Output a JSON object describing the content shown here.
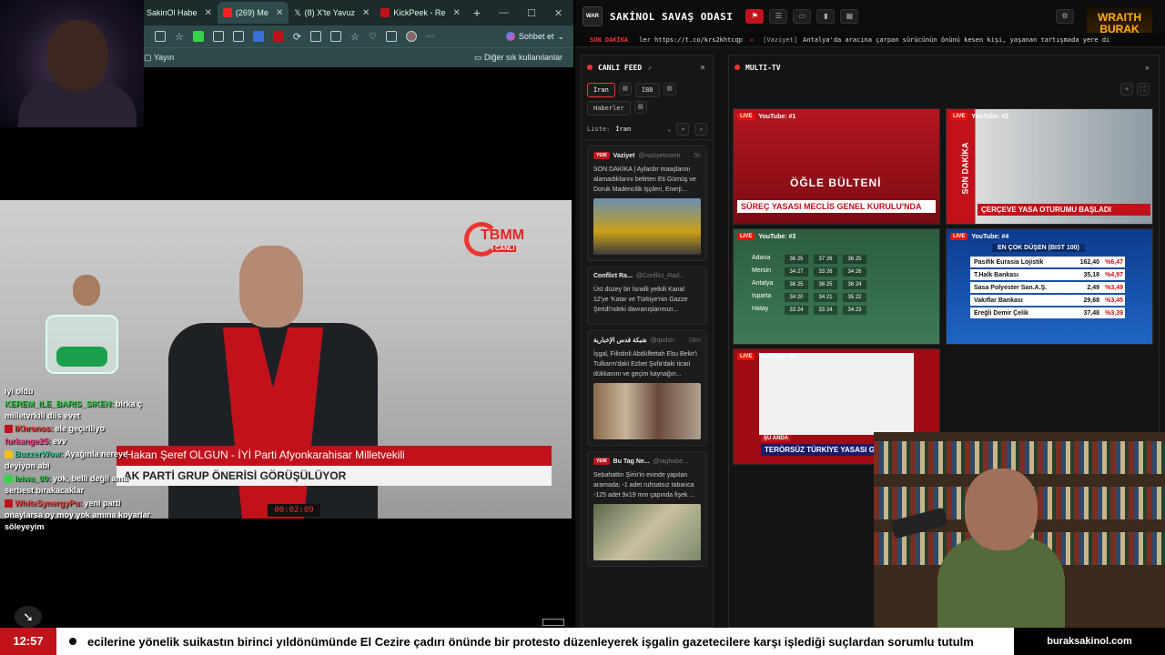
{
  "browser": {
    "tabs": [
      {
        "label": "SakinOl Habe",
        "color": "#ffffff"
      },
      {
        "label": "(269) Me",
        "color": "#ff2020"
      },
      {
        "label": "(8) X'te Yavuz",
        "color": "#ffffff"
      },
      {
        "label": "KickPeek - Re",
        "color": "#c1121b"
      }
    ],
    "chat_button": "Sohbet et",
    "bookmarks": {
      "left": "Yayın",
      "right": "Diğer sık kullanılanlar"
    }
  },
  "video": {
    "logo_text": "TBMM",
    "logo_sub": "CANLI",
    "lower_third_1": "Hakan Şeref OLGUN - İYİ Parti Afyonkarahisar Milletvekili",
    "lower_third_2": "AK PARTİ GRUP ÖNERİSİ GÖRÜŞÜLÜYOR",
    "timecode": "00:02:09"
  },
  "chat": [
    {
      "user": "",
      "text": "iyi oldu",
      "color": "#ffffff",
      "badge": ""
    },
    {
      "user": "KEREM_ILE_BARIS_SIKEN:",
      "text": "birka ç milletvrkili diis evet",
      "color": "#36d34b",
      "badge": ""
    },
    {
      "user": "IKhronos:",
      "text": "ele geçiriliyo",
      "color": "#ff3333",
      "badge": "#c1121b"
    },
    {
      "user": "furkange25:",
      "text": "evv",
      "color": "#ff3d8b",
      "badge": ""
    },
    {
      "user": "BuzzerWow:",
      "text": "Ayağınla nereye deyiyon abi",
      "color": "#36d3a0",
      "badge": "#f0c020"
    },
    {
      "user": "leiwa_00:",
      "text": "yok, belli değil ama serbest bırakacaklar",
      "color": "#36d34b",
      "badge": "#36d34b"
    },
    {
      "user": "WhiteSynergyPu:",
      "text": "yeni parti onaylarsa oy moy yok amına koyarlar söleyeyim",
      "color": "#ff4444",
      "badge": "#c1121b"
    }
  ],
  "dashboard": {
    "title": "SAKİNOL SAVAŞ ODASI",
    "brand": {
      "line1": "WRAITH",
      "line2": "BURAK",
      "color": "#ffb000"
    },
    "ticker": {
      "label": "SON DAKİKA",
      "url": "ler https://t.co/krs2khtcqp",
      "source": "[Vaziyet]",
      "text": "Antalya'da aracına çarpan sürücünün önünü kesen kişi, yaşanan tartışmada yere di"
    },
    "feed": {
      "title": "CANLI FEED",
      "tabs": [
        "İran",
        "İBB",
        "Haberler"
      ],
      "list_label": "Liste:",
      "list_value": "İran",
      "cards": [
        {
          "badge": "YENİ",
          "name": "Vaziyet",
          "handle": "@vaziyetcomtr",
          "time": "5h",
          "text": "SON DAKİKA | Aylardır maaşlarını alamadıklarını belirten Eti Gümüş ve Doruk Madencilik işçileri, Enerji...",
          "image_color": "#c9a018"
        },
        {
          "badge": "",
          "name": "Conflict Ra...",
          "handle": "@Conflict_Rad...",
          "time": "",
          "text": "Üst düzey bir İsrailli yetkili Kanal 12'ye 'Katar ve Türkiye'nin Gazze Şeridi'ndeki davranışlarımızı...",
          "image_color": ""
        },
        {
          "badge": "",
          "name": "شبكة قدس الإخبارية",
          "handle": "@qudsn",
          "time": "28m",
          "text": "İşgal, Filistinli Abdülfettah Ebu Bekir'i Tulkarm'daki Ezbet Şufa'daki ticari dükkanını ve geçim kaynağın...",
          "image_color": "#8a6a4a"
        },
        {
          "badge": "YENİ",
          "name": "Bu Tag Ne...",
          "handle": "@taghabe...",
          "time": "",
          "text": "Sebahattin Şirin'in evinde yapılan aramada: -1 adet ruhsatsız tabanca -125 adet 9x19 mm çapında fişek ...",
          "image_color": "#5a6a4a"
        }
      ]
    },
    "multitv": {
      "title": "MULTI-TV",
      "players": [
        {
          "live": "LIVE",
          "name": "YouTube: #1",
          "caption": "ÖĞLE BÜLTENİ",
          "headline": "SÜREÇ YASASI MECLİS GENEL KURULU'NDA"
        },
        {
          "live": "LIVE",
          "name": "YouTube: #2",
          "caption": "SON DAKİKA",
          "headline": "ÇERÇEVE YASA OTURUMU BAŞLADI"
        },
        {
          "live": "LIVE",
          "name": "YouTube: #3",
          "caption": "",
          "headline": "",
          "weather": [
            {
              "city": "Adana",
              "vals": [
                "36 25",
                "37 26",
                "36 25"
              ]
            },
            {
              "city": "Mersin",
              "vals": [
                "34 27",
                "33 26",
                "34 26"
              ]
            },
            {
              "city": "Antalya",
              "vals": [
                "36 25",
                "36 25",
                "36 24"
              ]
            },
            {
              "city": "Isparta",
              "vals": [
                "34 20",
                "34 21",
                "35 22"
              ]
            },
            {
              "city": "Hatay",
              "vals": [
                "33 24",
                "33 24",
                "34 23"
              ]
            }
          ]
        },
        {
          "live": "LIVE",
          "name": "YouTube: #4",
          "caption": "EN ÇOK DÜŞEN (BIST 100)",
          "headline": "",
          "stocks": [
            {
              "name": "Pasifik Eurasia Lojistik",
              "value": "162,40",
              "change": "%6,47"
            },
            {
              "name": "T.Halk Bankası",
              "value": "35,18",
              "change": "%4,97"
            },
            {
              "name": "Sasa Polyester San.A.Ş.",
              "value": "2,49",
              "change": "%3,49"
            },
            {
              "name": "Vakıflar Bankası",
              "value": "29,68",
              "change": "%3,45"
            },
            {
              "name": "Ereğli Demir Çelik",
              "value": "37,48",
              "change": "%3,39"
            }
          ]
        },
        {
          "live": "LIVE",
          "name": "YouTube: #5",
          "caption": "ŞU ANDA",
          "headline": "TERÖRSÜZ TÜRKİYE YASASI GÖRÜŞ"
        }
      ]
    }
  },
  "bottom": {
    "time": "12:57",
    "scroll_text": "ecilerine yönelik suikastın birinci yıldönümünde El Cezire çadırı önünde bir protesto düzenleyerek işgalin gazetecilere karşı işlediği suçlardan sorumlu tutulm",
    "site": "buraksakinol.com"
  }
}
